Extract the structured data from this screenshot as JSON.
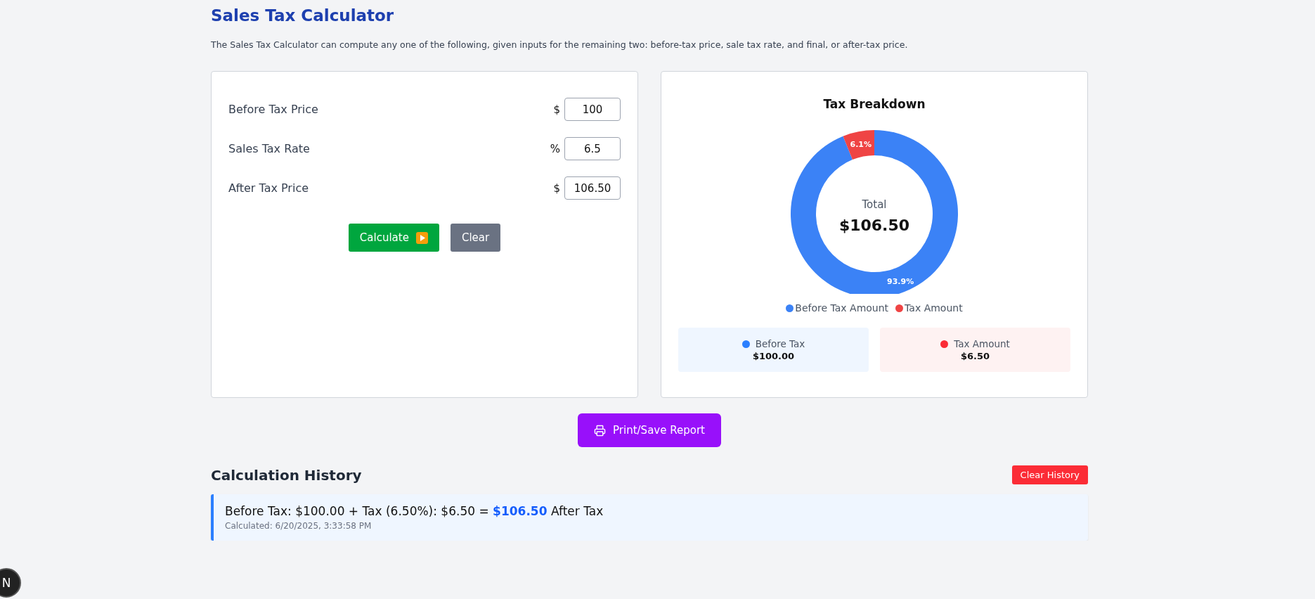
{
  "title": "Sales Tax Calculator",
  "description": "The Sales Tax Calculator can compute any one of the following, given inputs for the remaining two: before-tax price, sale tax rate, and final, or after-tax price.",
  "inputs": [
    {
      "label": "Before Tax Price",
      "unit": "$",
      "value": "100"
    },
    {
      "label": "Sales Tax Rate",
      "unit": "%",
      "value": "6.5"
    },
    {
      "label": "After Tax Price",
      "unit": "$",
      "value": "106.50"
    }
  ],
  "buttons": [
    {
      "kind": "calculate",
      "label": "Calculate"
    },
    {
      "kind": "clear",
      "label": "Clear"
    }
  ],
  "breakdown": {
    "chart_data": {
      "type": "donut",
      "title": "Tax Breakdown",
      "categories": [
        "Before Tax Amount",
        "Tax Amount"
      ],
      "values": [
        93.9,
        6.1
      ],
      "colors": [
        "#3b82f6",
        "#ef4444"
      ],
      "value_labels": [
        "93.9%",
        "6.1%"
      ]
    },
    "center_label": "Total",
    "center_value": "$106.50",
    "summary": [
      {
        "label": "Before Tax",
        "value": "$100.00",
        "color": "#2b7fff"
      },
      {
        "label": "Tax Amount",
        "value": "$6.50",
        "color": "#fb2c36"
      }
    ]
  },
  "print_button": "Print/Save Report",
  "history": {
    "title": "Calculation History",
    "clear_button": "Clear History",
    "entries": [
      {
        "text": "Before Tax: $100.00 + Tax (6.50%): $6.50 = **$106.50** After Tax",
        "time": "Calculated: 6/20/2025, 3:33:58 PM"
      }
    ]
  },
  "dev_badge": "N"
}
